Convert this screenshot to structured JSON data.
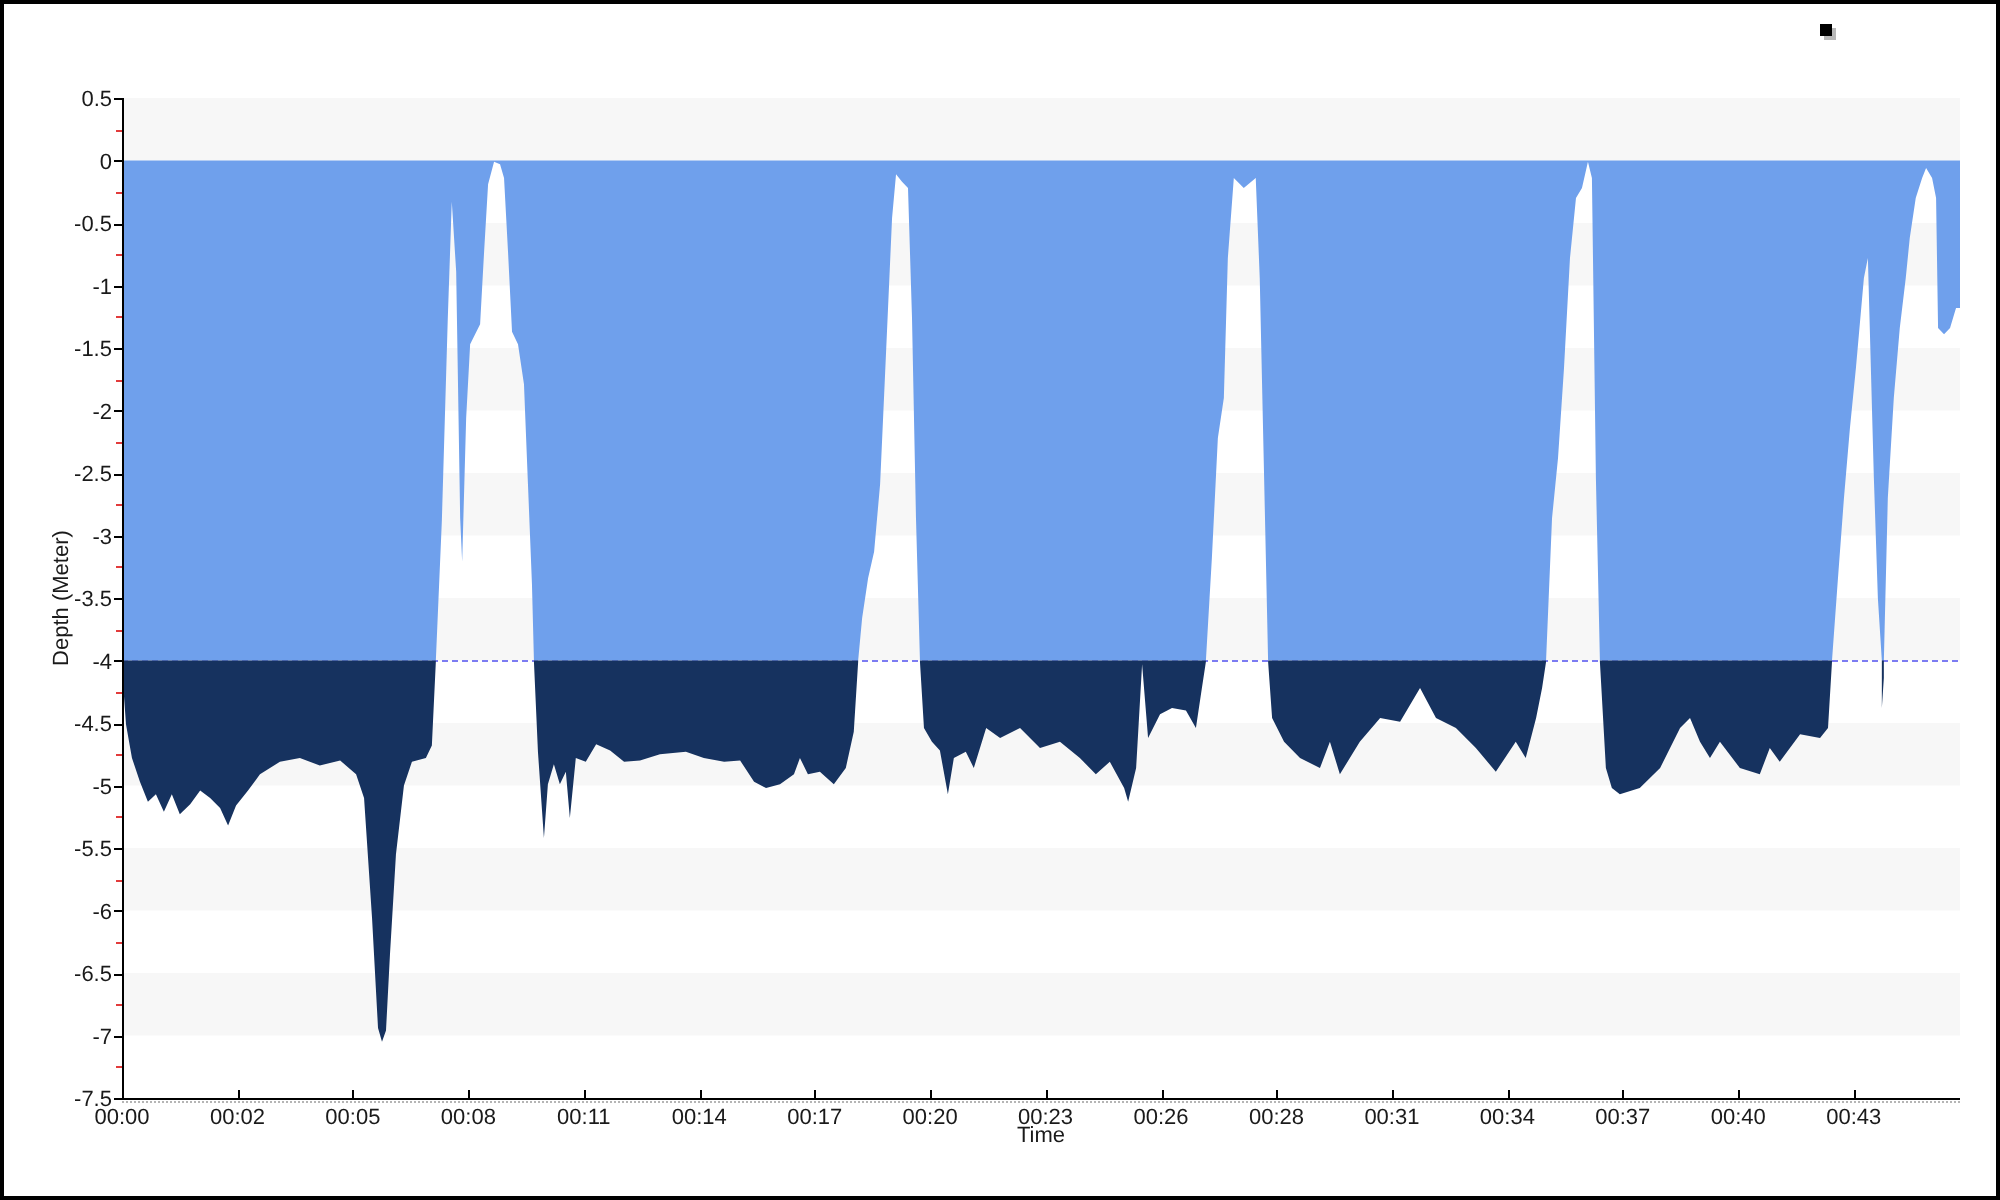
{
  "chart": {
    "chart_data": {
      "type": "area",
      "xlabel": "Time",
      "ylabel": "Depth (Meter)",
      "stacked": true,
      "x": [
        -0.475,
        -0.375,
        -0.225,
        -0.025,
        0.175,
        0.375,
        0.575,
        0.775,
        0.975,
        1.235,
        1.485,
        1.735,
        1.985,
        2.185,
        2.385,
        2.685,
        2.985,
        3.485,
        3.985,
        4.485,
        4.995,
        5.395,
        5.595,
        5.795,
        5.945,
        6.045,
        6.145,
        6.245,
        6.395,
        6.595,
        6.795,
        7.145,
        7.295,
        7.395,
        7.545,
        7.695,
        7.795,
        7.905,
        8.005,
        8.055,
        8.155,
        8.255,
        8.505,
        8.605,
        8.705,
        8.855,
        9.005,
        9.105,
        9.205,
        9.305,
        9.455,
        9.605,
        9.705,
        9.805,
        9.855,
        9.955,
        10.105,
        10.205,
        10.355,
        10.505,
        10.655,
        10.755,
        10.905,
        11.155,
        11.415,
        11.765,
        12.115,
        12.515,
        13.015,
        13.665,
        14.115,
        14.625,
        15.025,
        15.375,
        15.675,
        16.025,
        16.375,
        16.525,
        16.725,
        17.025,
        17.375,
        17.675,
        17.875,
        17.985,
        18.085,
        18.235,
        18.385,
        18.535,
        18.685,
        18.835,
        18.935,
        19.085,
        19.235,
        19.335,
        19.435,
        19.535,
        19.635,
        19.835,
        20.035,
        20.235,
        20.385,
        20.685,
        20.885,
        21.195,
        21.545,
        22.045,
        22.545,
        23.045,
        23.545,
        23.945,
        24.295,
        24.655,
        24.755,
        24.955,
        25.105,
        25.255,
        25.555,
        25.855,
        26.205,
        26.455,
        26.605,
        26.705,
        26.855,
        27.005,
        27.155,
        27.255,
        27.405,
        27.655,
        27.955,
        28.055,
        28.165,
        28.265,
        28.365,
        28.665,
        29.065,
        29.565,
        29.815,
        30.065,
        30.565,
        31.075,
        31.575,
        32.075,
        32.475,
        32.975,
        33.475,
        33.975,
        34.475,
        34.725,
        34.985,
        35.135,
        35.235,
        35.385,
        35.535,
        35.685,
        35.835,
        35.985,
        36.135,
        36.285,
        36.385,
        36.485,
        36.585,
        36.735,
        36.885,
        37.085,
        37.585,
        38.095,
        38.595,
        38.845,
        39.095,
        39.345,
        39.595,
        40.095,
        40.595,
        40.845,
        41.095,
        41.605,
        42.105,
        42.305,
        42.405,
        42.555,
        42.705,
        42.855,
        43.005,
        43.205,
        43.305,
        43.455,
        43.555,
        43.655,
        43.705,
        43.805,
        43.955,
        44.105,
        44.255,
        44.355,
        44.505,
        44.665,
        44.765,
        44.915,
        45.015,
        45.065,
        45.215,
        45.365,
        45.515,
        45.615
      ],
      "series": [
        {
          "color": "#6fa0ec",
          "values": [
            -4,
            -4,
            -4,
            -4,
            -4,
            -4,
            -4,
            -4,
            -4,
            -4,
            -4,
            -4,
            -4,
            -4,
            -4,
            -4,
            -4,
            -4,
            -4,
            -4,
            -4,
            -4,
            -4,
            -4,
            -4,
            -4,
            -4,
            -4,
            -4,
            -4,
            -4,
            -4,
            -4,
            -4,
            -2.89,
            -1.26,
            -0.33,
            -0.89,
            -2.86,
            -3.21,
            -2.06,
            -1.47,
            -1.31,
            -0.73,
            -0.19,
            -0.01,
            -0.03,
            -0.14,
            -0.73,
            -1.37,
            -1.47,
            -1.79,
            -2.59,
            -3.39,
            -4,
            -4,
            -4,
            -4,
            -4,
            -4,
            -4,
            -4,
            -4,
            -4,
            -4,
            -4,
            -4,
            -4,
            -4,
            -4,
            -4,
            -4,
            -4,
            -4,
            -4,
            -4,
            -4,
            -4,
            -4,
            -4,
            -4,
            -4,
            -4,
            -4,
            -3.66,
            -3.34,
            -3.13,
            -2.59,
            -1.53,
            -0.46,
            -0.11,
            -0.17,
            -0.22,
            -1.26,
            -2.86,
            -4,
            -4,
            -4,
            -4,
            -4,
            -4,
            -4,
            -4,
            -4,
            -4,
            -4,
            -4,
            -4,
            -4,
            -4,
            -4,
            -4,
            -4,
            -4,
            -4,
            -4,
            -4,
            -4,
            -4,
            -4,
            -4,
            -4,
            -3.18,
            -2.22,
            -1.9,
            -0.78,
            -0.14,
            -0.22,
            -0.14,
            -0.94,
            -2.54,
            -4,
            -4,
            -4,
            -4,
            -4,
            -4,
            -4,
            -4,
            -4,
            -4,
            -4,
            -4,
            -4,
            -4,
            -4,
            -4,
            -4,
            -4,
            -4,
            -4,
            -2.86,
            -2.38,
            -1.66,
            -0.78,
            -0.3,
            -0.22,
            -0.01,
            -0.14,
            -2.54,
            -4,
            -4,
            -4,
            -4,
            -4,
            -4,
            -4,
            -4,
            -4,
            -4,
            -4,
            -4,
            -4,
            -4,
            -4,
            -4,
            -4,
            -4,
            -4,
            -3.34,
            -2.7,
            -2.14,
            -1.66,
            -0.94,
            -0.78,
            -2.54,
            -3.5,
            -4,
            -4,
            -2.7,
            -1.9,
            -1.34,
            -0.94,
            -0.62,
            -0.3,
            -0.14,
            -0.06,
            -0.14,
            -0.3,
            -1.34,
            -1.39,
            -1.34,
            -1.18,
            -1.18
          ]
        },
        {
          "color": "#16325f",
          "values": [
            -0.06,
            -0.51,
            -0.78,
            -0.97,
            -1.13,
            -1.07,
            -1.21,
            -1.07,
            -1.23,
            -1.15,
            -1.04,
            -1.1,
            -1.18,
            -1.32,
            -1.16,
            -1.04,
            -0.91,
            -0.81,
            -0.78,
            -0.84,
            -0.8,
            -0.91,
            -1.1,
            -2.06,
            -2.94,
            -3.05,
            -2.96,
            -2.35,
            -1.55,
            -1.0,
            -0.81,
            -0.78,
            -0.68,
            -0.01,
            null,
            null,
            null,
            null,
            null,
            null,
            null,
            null,
            null,
            null,
            null,
            null,
            null,
            null,
            null,
            null,
            null,
            null,
            null,
            null,
            -0.01,
            -0.73,
            -1.42,
            -0.99,
            -0.83,
            -0.99,
            -0.89,
            -1.26,
            -0.78,
            -0.81,
            -0.67,
            -0.72,
            -0.81,
            -0.8,
            -0.75,
            -0.73,
            -0.78,
            -0.81,
            -0.8,
            -0.97,
            -1.02,
            -0.99,
            -0.91,
            -0.78,
            -0.91,
            -0.89,
            -0.99,
            -0.86,
            -0.57,
            -0.01,
            null,
            null,
            null,
            null,
            null,
            null,
            null,
            null,
            null,
            null,
            null,
            -0.01,
            -0.54,
            -0.65,
            -0.72,
            -1.07,
            -0.78,
            -0.73,
            -0.86,
            -0.54,
            -0.62,
            -0.54,
            -0.7,
            -0.65,
            -0.78,
            -0.91,
            -0.81,
            -1.02,
            -1.13,
            -0.86,
            -0.03,
            -0.62,
            -0.43,
            -0.38,
            -0.4,
            -0.54,
            -0.22,
            -0.01,
            null,
            null,
            null,
            null,
            null,
            null,
            null,
            null,
            null,
            -0.01,
            -0.46,
            -0.65,
            -0.78,
            -0.86,
            -0.65,
            -0.91,
            -0.65,
            -0.46,
            -0.49,
            -0.22,
            -0.46,
            -0.54,
            -0.7,
            -0.89,
            -0.65,
            -0.78,
            -0.46,
            -0.22,
            -0.01,
            null,
            null,
            null,
            null,
            null,
            null,
            null,
            null,
            null,
            -0.01,
            -0.86,
            -1.02,
            -1.07,
            -1.02,
            -0.86,
            -0.54,
            -0.46,
            -0.65,
            -0.78,
            -0.65,
            -0.86,
            -0.91,
            -0.7,
            -0.81,
            -0.59,
            -0.62,
            -0.54,
            -0.01,
            null,
            null,
            null,
            null,
            null,
            null,
            null,
            null,
            -0.38,
            -0.14,
            null,
            null,
            null,
            null,
            null,
            null,
            null,
            null,
            null,
            null,
            null,
            null,
            null,
            null,
            null
          ]
        }
      ],
      "xlim": [
        -0.475,
        45.615
      ],
      "ylim": [
        -7.5,
        0.5
      ],
      "xticks": [
        {
          "value": -0.475,
          "label": "00:00"
        },
        {
          "value": 2.42,
          "label": "00:02"
        },
        {
          "value": 5.315,
          "label": "00:05"
        },
        {
          "value": 8.21,
          "label": "00:08"
        },
        {
          "value": 11.105,
          "label": "00:11"
        },
        {
          "value": 14.0,
          "label": "00:14"
        },
        {
          "value": 16.895,
          "label": "00:17"
        },
        {
          "value": 19.79,
          "label": "00:20"
        },
        {
          "value": 22.685,
          "label": "00:23"
        },
        {
          "value": 25.58,
          "label": "00:26"
        },
        {
          "value": 28.475,
          "label": "00:28"
        },
        {
          "value": 31.37,
          "label": "00:31"
        },
        {
          "value": 34.265,
          "label": "00:34"
        },
        {
          "value": 37.16,
          "label": "00:37"
        },
        {
          "value": 40.055,
          "label": "00:40"
        },
        {
          "value": 42.95,
          "label": "00:43"
        }
      ],
      "yticks": [
        0.5,
        0,
        -0.5,
        -1,
        -1.5,
        -2,
        -2.5,
        -3,
        -3.5,
        -4,
        -4.5,
        -5,
        -5.5,
        -6,
        -6.5,
        -7,
        -7.5
      ],
      "ref_lines": [
        {
          "axis": "y",
          "value": -4
        }
      ]
    }
  }
}
